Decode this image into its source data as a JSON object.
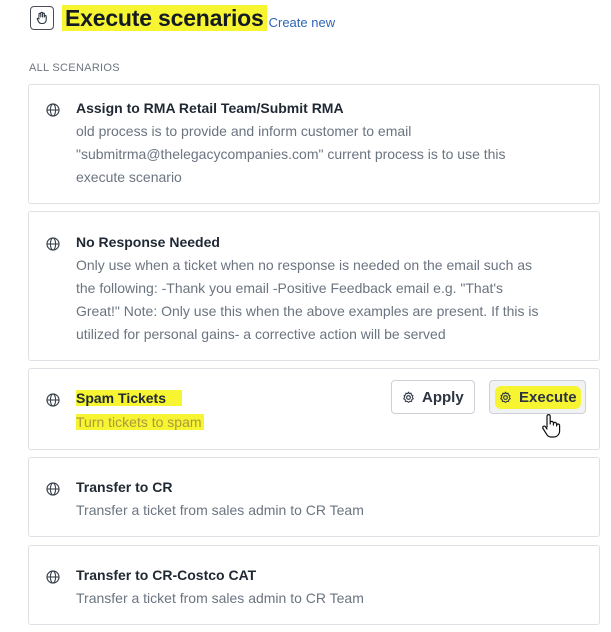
{
  "header": {
    "title": "Execute scenarios",
    "create_link": "Create new",
    "icon": "scenario-icon"
  },
  "section_label": "ALL SCENARIOS",
  "scenarios": [
    {
      "title": "Assign to RMA Retail Team/Submit RMA",
      "desc_lines": [
        "old process is to provide and inform customer to email",
        "\"submitrma@thelegacycompanies.com\" current process is to use this",
        "execute scenario"
      ],
      "icon": "globe-icon"
    },
    {
      "title": "No Response Needed",
      "desc_lines": [
        "Only use when a ticket when no response is needed on the email such as",
        "the following: -Thank you email -Positive Feedback email e.g. \"That's",
        "Great!\" Note: Only use this when the above examples are present. If this is",
        "utilized for personal gains- a corrective action will be served"
      ],
      "icon": "globe-icon"
    },
    {
      "title": "Spam Tickets",
      "desc_lines": [
        "Turn tickets to spam"
      ],
      "icon": "globe-icon",
      "apply_label": "Apply",
      "execute_label": "Execute"
    },
    {
      "title": "Transfer to CR",
      "desc_lines": [
        "Transfer a ticket from sales admin to CR Team"
      ],
      "icon": "globe-icon"
    },
    {
      "title": "Transfer to CR-Costco CAT",
      "desc_lines": [
        "Transfer a ticket from sales admin to CR Team"
      ],
      "icon": "globe-icon"
    }
  ],
  "colors": {
    "highlight": "#f7f432",
    "link": "#2f66b3",
    "border": "#dde1e6",
    "muted_text": "#6b7480"
  }
}
